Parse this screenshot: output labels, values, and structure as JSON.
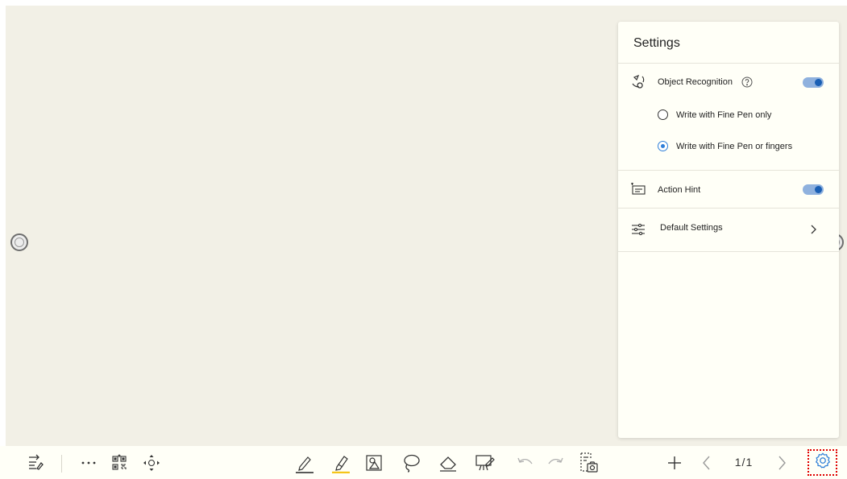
{
  "settings_panel": {
    "title": "Settings",
    "object_recognition": {
      "label": "Object Recognition",
      "enabled": true,
      "options": [
        {
          "label": "Write with Fine Pen only",
          "selected": false
        },
        {
          "label": "Write with Fine Pen or fingers",
          "selected": true
        }
      ]
    },
    "action_hint": {
      "label": "Action Hint",
      "enabled": true
    },
    "default_settings": {
      "label": "Default Settings"
    }
  },
  "toolbar": {
    "page_indicator": "1/1",
    "icons": [
      "notebook-switch-icon",
      "more-icon",
      "qr-code-icon",
      "move-icon",
      "fine-pen-icon",
      "highlighter-icon",
      "shape-icon",
      "lasso-icon",
      "eraser-icon",
      "present-icon",
      "undo-icon",
      "redo-icon",
      "screenshot-icon",
      "add-page-icon",
      "prev-page-icon",
      "next-page-icon",
      "settings-icon"
    ]
  },
  "colors": {
    "canvas": "#f2f0e6",
    "panel": "#fffff7",
    "accent": "#1a5fb4",
    "highlighter": "#f5c518",
    "selection_outline": "#e00000"
  }
}
